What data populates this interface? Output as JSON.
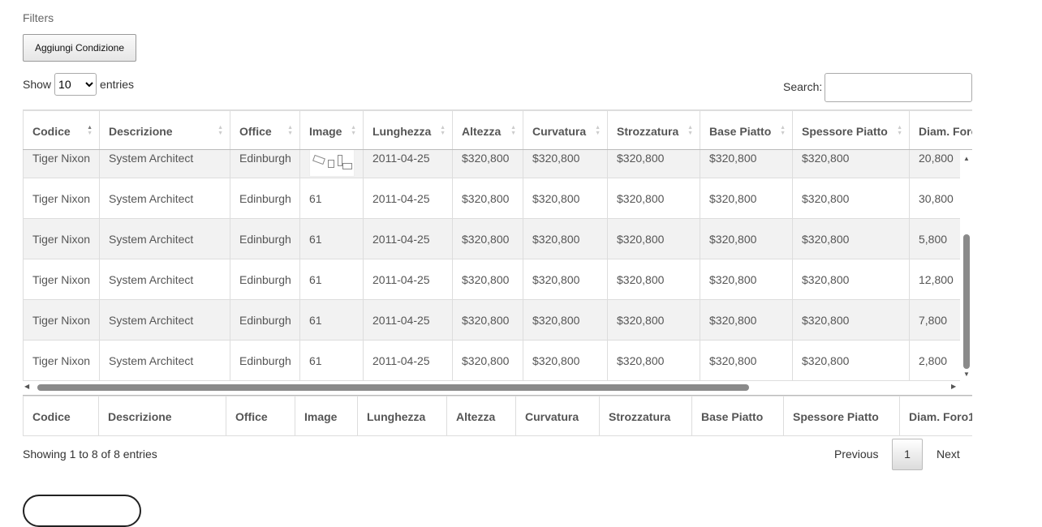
{
  "filters": {
    "label": "Filters",
    "add_condition_label": "Aggiungi Condizione"
  },
  "length_menu": {
    "show_label": "Show",
    "selected": "10",
    "entries_label": "entries"
  },
  "search": {
    "label": "Search:",
    "value": "",
    "placeholder": ""
  },
  "columns": [
    "Codice",
    "Descrizione",
    "Office",
    "Image",
    "Lunghezza",
    "Altezza",
    "Curvatura",
    "Strozzatura",
    "Base Piatto",
    "Spessore Piatto",
    "Diam. Foro1"
  ],
  "sorted_column": "Codice",
  "rows": [
    [
      "Tiger Nixon",
      "System Architect",
      "Edinburgh",
      "",
      "2011-04-25",
      "$320,800",
      "$320,800",
      "$320,800",
      "$320,800",
      "$320,800",
      "20,800"
    ],
    [
      "Tiger Nixon",
      "System Architect",
      "Edinburgh",
      "61",
      "2011-04-25",
      "$320,800",
      "$320,800",
      "$320,800",
      "$320,800",
      "$320,800",
      "30,800"
    ],
    [
      "Tiger Nixon",
      "System Architect",
      "Edinburgh",
      "61",
      "2011-04-25",
      "$320,800",
      "$320,800",
      "$320,800",
      "$320,800",
      "$320,800",
      "5,800"
    ],
    [
      "Tiger Nixon",
      "System Architect",
      "Edinburgh",
      "61",
      "2011-04-25",
      "$320,800",
      "$320,800",
      "$320,800",
      "$320,800",
      "$320,800",
      "12,800"
    ],
    [
      "Tiger Nixon",
      "System Architect",
      "Edinburgh",
      "61",
      "2011-04-25",
      "$320,800",
      "$320,800",
      "$320,800",
      "$320,800",
      "$320,800",
      "7,800"
    ],
    [
      "Tiger Nixon",
      "System Architect",
      "Edinburgh",
      "61",
      "2011-04-25",
      "$320,800",
      "$320,800",
      "$320,800",
      "$320,800",
      "$320,800",
      "2,800"
    ]
  ],
  "info": "Showing 1 to 8 of 8 entries",
  "pagination": {
    "previous": "Previous",
    "current_page": "1",
    "next": "Next"
  },
  "colors": {
    "stripe": "#f2f2f2",
    "border": "#dddddd",
    "scrollbar_thumb": "#8a8a8a"
  }
}
